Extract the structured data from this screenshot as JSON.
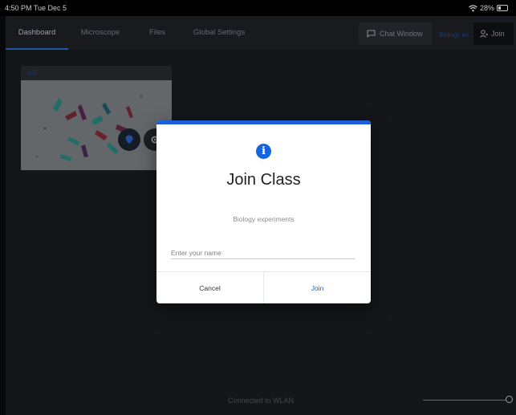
{
  "status_bar": {
    "time": "4:50 PM  Tue Dec 5",
    "battery": "28%"
  },
  "nav": {
    "tabs": [
      {
        "label": "Dashboard",
        "active": true
      },
      {
        "label": "Microscope"
      },
      {
        "label": "Files"
      },
      {
        "label": "Global Settings"
      }
    ],
    "chat_window_label": "Chat Window",
    "class_name_short": "Biology ex...",
    "join_label": "Join"
  },
  "card": {
    "title": "ss5"
  },
  "footer": {
    "connection_status": "Connected to WLAN"
  },
  "modal": {
    "title": "Join Class",
    "subtitle": "Biology experiments",
    "name_placeholder": "Enter your name",
    "name_value": "",
    "cancel_label": "Cancel",
    "join_label": "Join"
  },
  "colors": {
    "accent": "#1a5fd8",
    "background": "#1a1d21"
  },
  "icons": [
    "wifi-icon",
    "battery-icon",
    "chat-icon",
    "person-icon",
    "info-icon",
    "pin-icon",
    "gear-icon"
  ]
}
